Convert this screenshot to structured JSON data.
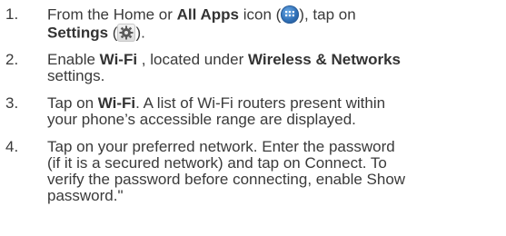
{
  "steps": [
    {
      "number": "1.",
      "parts": {
        "t1": "From the Home or ",
        "b1": "All Apps",
        "t2": " icon (",
        "t3": "), tap on",
        "b2": "Settings",
        "t4": " (",
        "t5": ")."
      },
      "icons": [
        "all-apps-icon",
        "settings-gear-icon"
      ]
    },
    {
      "number": "2.",
      "parts": {
        "t1": "Enable ",
        "b1": "Wi-Fi",
        "t2": " , located under ",
        "b2": "Wireless & Networks",
        "t3": "settings."
      }
    },
    {
      "number": "3.",
      "parts": {
        "t1": "Tap on ",
        "b1": "Wi-Fi",
        "t2": ". A list of Wi-Fi routers present within",
        "t3": "your phone’s accessible range are displayed."
      }
    },
    {
      "number": "4.",
      "lines": [
        "Tap on your preferred network. Enter the password",
        "(if it is a secured network) and tap on Connect. To",
        "verify the password before connecting, enable Show",
        "password.\""
      ]
    }
  ]
}
